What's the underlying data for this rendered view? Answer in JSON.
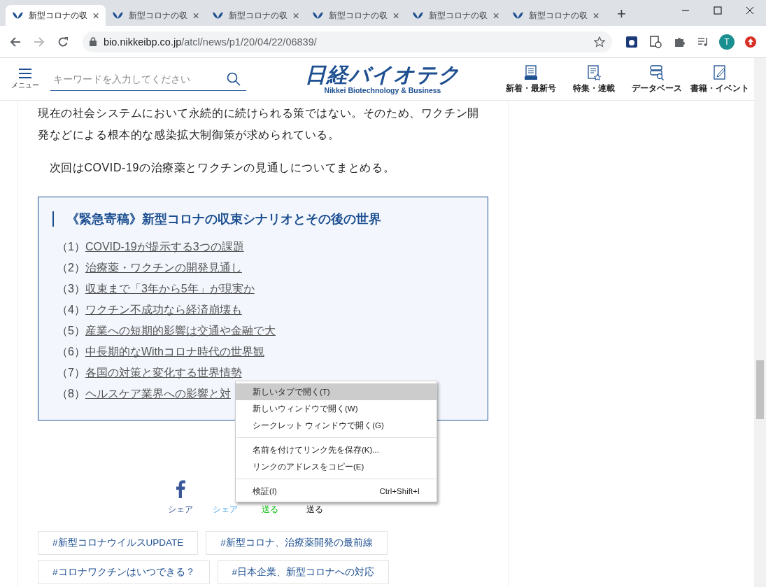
{
  "browser": {
    "tabs": [
      {
        "title": "新型コロナの収",
        "selected": true
      },
      {
        "title": "新型コロナの収",
        "selected": false
      },
      {
        "title": "新型コロナの収",
        "selected": false
      },
      {
        "title": "新型コロナの収",
        "selected": false
      },
      {
        "title": "新型コロナの収",
        "selected": false
      },
      {
        "title": "新型コロナの収",
        "selected": false
      }
    ],
    "new_tab": "+",
    "avatar": "T",
    "address": {
      "host": "bio.nikkeibp.co.jp",
      "path": "/atcl/news/p1/20/04/22/06839/"
    }
  },
  "header": {
    "menu_label": "メニュー",
    "search": {
      "placeholder": "キーワードを入力してください"
    },
    "logo": {
      "title": "日経バイオテク",
      "subtitle": "Nikkei Biotechnology & Business"
    },
    "nav": [
      {
        "label": "新着・最新号",
        "kind": "new"
      },
      {
        "label": "特集・連載",
        "kind": "feature"
      },
      {
        "label": "データベース",
        "kind": "database"
      },
      {
        "label": "書籍・イベント",
        "kind": "book"
      }
    ]
  },
  "article": {
    "paragraphs": [
      "現在の社会システムにおいて永続的に続けられる策ではない。そのため、ワクチン開発などによる根本的な感染拡大制御策が求められている。",
      "　次回はCOVID-19の治療薬とワクチンの見通しについてまとめる。"
    ],
    "series": {
      "title": "《緊急寄稿》新型コロナの収束シナリオとその後の世界",
      "items": [
        {
          "number": "（1）",
          "link": "COVID-19が提示する3つの課題"
        },
        {
          "number": "（2）",
          "link": "治療薬・ワクチンの開発見通し"
        },
        {
          "number": "（3）",
          "link": "収束まで「3年から5年」が現実か"
        },
        {
          "number": "（4）",
          "link": "ワクチン不成功なら経済崩壊も"
        },
        {
          "number": "（5）",
          "link": "産業への短期的影響は交通や金融で大"
        },
        {
          "number": "（6）",
          "link": "中長期的なWithコロナ時代の世界観"
        },
        {
          "number": "（7）",
          "link": "各国の対策と変化する世界情勢"
        },
        {
          "number": "（8）",
          "link": "ヘルスケア業界への影響と対"
        }
      ]
    },
    "share": [
      {
        "label": "シェア",
        "kind": "facebook"
      },
      {
        "label": "シェア",
        "kind": "twitter"
      },
      {
        "label": "送る",
        "kind": "line"
      },
      {
        "label": "送る",
        "kind": "other"
      }
    ],
    "tags": [
      "#新型コロナウイルスUPDATE",
      "#新型コロナ、治療薬開発の最前線",
      "#コロナワクチンはいつできる？",
      "#日本企業、新型コロナへの対応"
    ]
  },
  "context_menu": {
    "groups": [
      [
        {
          "label": "新しいタブで開く(T)",
          "selected": true
        },
        {
          "label": "新しいウィンドウで開く(W)",
          "selected": false
        },
        {
          "label": "シークレット ウィンドウで開く(G)",
          "selected": false
        }
      ],
      [
        {
          "label": "名前を付けてリンク先を保存(K)...",
          "selected": false
        },
        {
          "label": "リンクのアドレスをコピー(E)",
          "selected": false
        }
      ],
      [
        {
          "label": "検証(I)",
          "shortcut": "Ctrl+Shift+I",
          "selected": false
        }
      ]
    ]
  }
}
